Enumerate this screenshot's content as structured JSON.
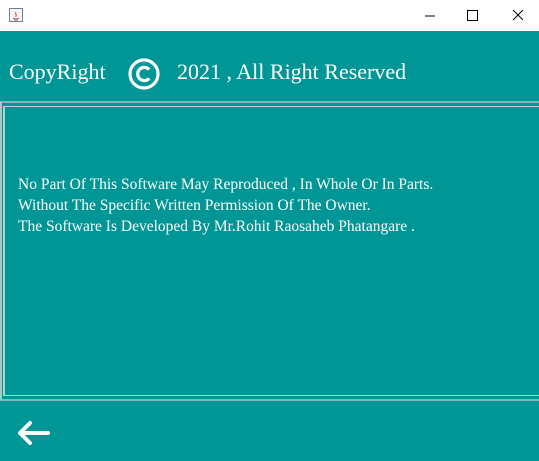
{
  "titlebar": {
    "minimize_icon": "minimize-icon",
    "maximize_icon": "maximize-icon",
    "close_icon": "close-icon"
  },
  "header": {
    "label_left": "CopyRight",
    "copyright_icon": "copyright-icon",
    "label_right": "2021 , All Right Reserved"
  },
  "notice": {
    "lines": [
      "No Part Of This Software May Reproduced , In Whole Or In Parts.",
      "Without The Specific Written Permission Of The Owner.",
      "The Software Is Developed By Mr.Rohit Raosaheb Phatangare ."
    ]
  },
  "footer": {
    "back_icon": "arrow-left-icon"
  },
  "colors": {
    "background": "#009696",
    "text": "#ffffff",
    "titlebar": "#ffffff"
  }
}
